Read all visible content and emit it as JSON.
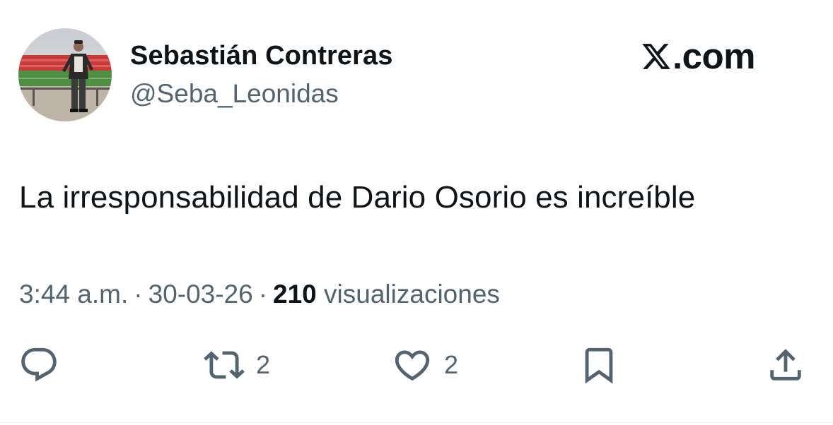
{
  "author": {
    "display_name": "Sebastián Contreras",
    "handle": "@Seba_Leonidas",
    "avatar_icon": "profile-photo"
  },
  "brand": {
    "label": ".com",
    "icon": "x-logo-icon"
  },
  "tweet": {
    "text": "La irresponsabilidad de Dario Osorio es increíble"
  },
  "meta": {
    "time": "3:44 a.m.",
    "date": "30-03-26",
    "separator": "·",
    "views_count": "210",
    "views_label": "visualizaciones"
  },
  "actions": {
    "reply": {
      "icon": "reply-icon",
      "count": ""
    },
    "retweet": {
      "icon": "retweet-icon",
      "count": "2"
    },
    "like": {
      "icon": "heart-icon",
      "count": "2"
    },
    "bookmark": {
      "icon": "bookmark-icon",
      "count": ""
    },
    "share": {
      "icon": "share-icon",
      "count": ""
    }
  },
  "colors": {
    "text_primary": "#0f1419",
    "text_secondary": "#536471",
    "background": "#ffffff"
  }
}
